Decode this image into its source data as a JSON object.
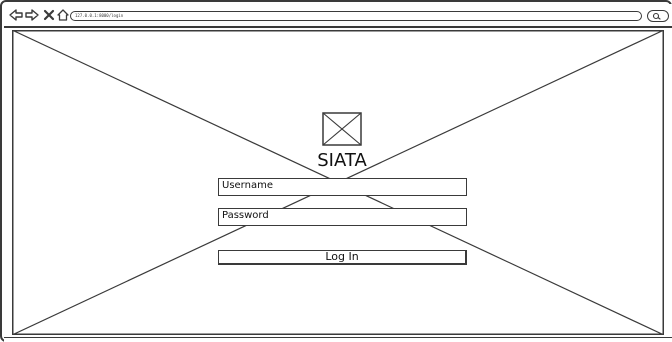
{
  "browser": {
    "url": "127.0.0.1:8000/login",
    "icons": {
      "back": "back-arrow-icon",
      "forward": "forward-arrow-icon",
      "stop": "close-icon",
      "home": "home-icon",
      "search": "search-icon"
    }
  },
  "login": {
    "logo_icon": "image-placeholder-icon",
    "title": "SIATA",
    "username_label": "Username",
    "password_label": "Password",
    "submit_label": "Log In"
  },
  "colors": {
    "stroke": "#3a3a3a",
    "background": "#ffffff",
    "text": "#111111"
  }
}
